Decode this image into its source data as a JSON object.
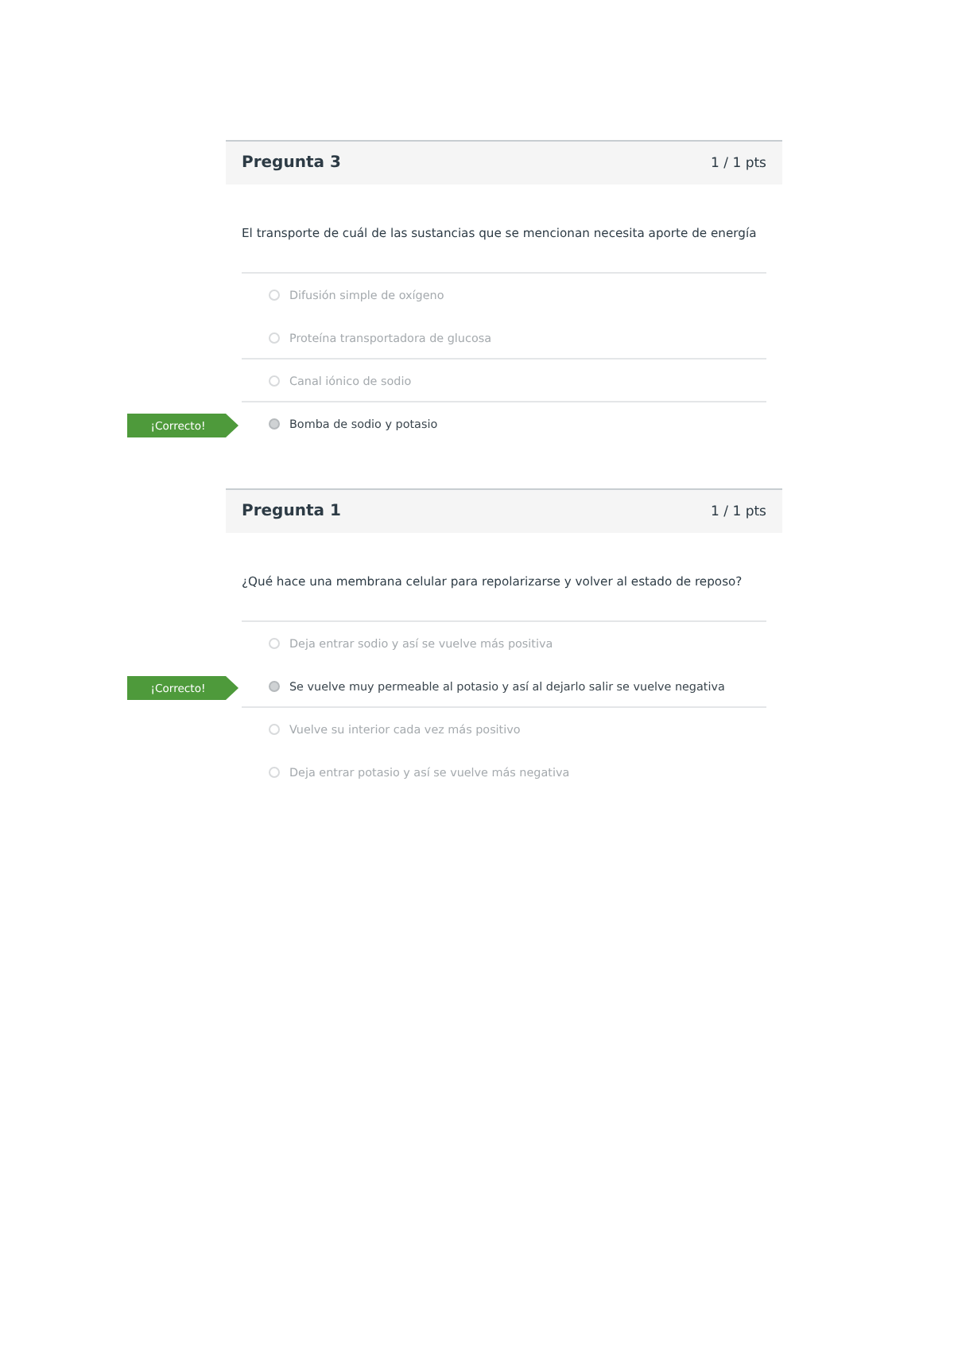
{
  "questions": [
    {
      "title": "Pregunta 3",
      "points": "1 / 1 pts",
      "text": "El transporte de cuál de las sustancias que se mencionan necesita aporte de energía",
      "result_label": "¡Correcto!",
      "options": [
        {
          "label": "Difusión simple de oxígeno",
          "selected": false,
          "divider": true
        },
        {
          "label": "Proteína transportadora de glucosa",
          "selected": false,
          "divider": false
        },
        {
          "label": "Canal iónico de sodio",
          "selected": false,
          "divider": true
        },
        {
          "label": "Bomba de sodio y potasio",
          "selected": true,
          "divider": true
        }
      ]
    },
    {
      "title": "Pregunta 1",
      "points": "1 / 1 pts",
      "text": "¿Qué hace una membrana celular para repolarizarse y volver al estado de reposo?",
      "result_label": "¡Correcto!",
      "options": [
        {
          "label": "Deja entrar sodio y así se vuelve más positiva",
          "selected": false,
          "divider": true
        },
        {
          "label": "Se vuelve muy permeable al potasio y así al dejarlo salir se vuelve negativa",
          "selected": true,
          "divider": false
        },
        {
          "label": "Vuelve su interior cada vez más positivo",
          "selected": false,
          "divider": true
        },
        {
          "label": "Deja entrar potasio y así se vuelve más negativa",
          "selected": false,
          "divider": false
        }
      ]
    }
  ]
}
